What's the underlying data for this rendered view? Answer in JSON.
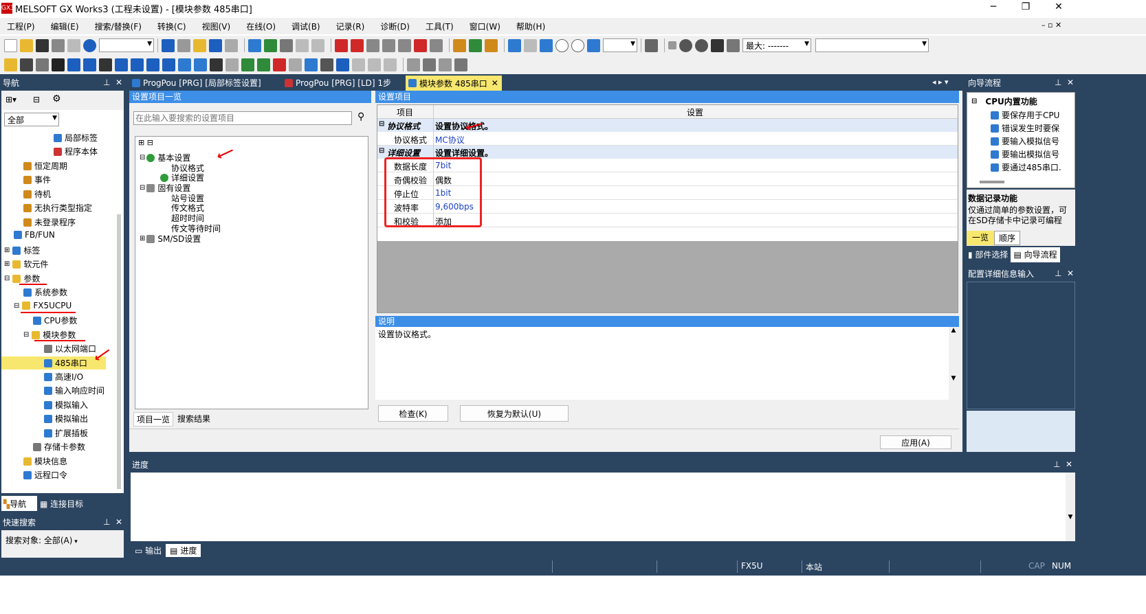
{
  "window": {
    "logo": "GX3",
    "title": "MELSOFT GX Works3 (工程未设置) - [模块参数 485串口]"
  },
  "menu": [
    "工程(P)",
    "编辑(E)",
    "搜索/替换(F)",
    "转换(C)",
    "视图(V)",
    "在线(O)",
    "调试(B)",
    "记录(R)",
    "诊断(D)",
    "工具(T)",
    "窗口(W)",
    "帮助(H)"
  ],
  "toolbar": {
    "zoom_label": "最大: -------"
  },
  "nav": {
    "title": "导航",
    "filter": "全部",
    "items": [
      "局部标签",
      "程序本体",
      "恒定周期",
      "事件",
      "待机",
      "无执行类型指定",
      "未登录程序",
      "FB/FUN",
      "标签",
      "软元件",
      "参数",
      "系统参数",
      "FX5UCPU",
      "CPU参数",
      "模块参数",
      "以太网端口",
      "485串口",
      "高速I/O",
      "输入响应时间",
      "模拟输入",
      "模拟输出",
      "扩展插板",
      "存储卡参数",
      "模块信息",
      "远程口令"
    ],
    "tabs": [
      "导航",
      "连接目标"
    ]
  },
  "quick_search": {
    "title": "快速搜索",
    "target": "搜索对象: 全部(A)"
  },
  "tabs": [
    "ProgPou [PRG] [局部标签设置]",
    "ProgPou [PRG] [LD] 1步",
    "模块参数 485串口"
  ],
  "settings_list": {
    "title": "设置项目一览",
    "search_placeholder": "在此输入要搜索的设置项目",
    "tree": [
      "基本设置",
      "协议格式",
      "详细设置",
      "固有设置",
      "站号设置",
      "传文格式",
      "超时时间",
      "传文等待时间",
      "SM/SD设置"
    ],
    "bottom_tabs": [
      "项目一览",
      "搜索结果"
    ]
  },
  "settings_items": {
    "title": "设置项目",
    "col_item": "项目",
    "col_setting": "设置",
    "group1": {
      "name": "协议格式",
      "desc": "设置协议格式。"
    },
    "row_protocol": {
      "label": "协议格式",
      "value": "MC协议"
    },
    "group2": {
      "name": "详细设置",
      "desc": "设置详细设置。"
    },
    "rows": [
      {
        "label": "数据长度",
        "value": "7bit"
      },
      {
        "label": "奇偶校验",
        "value": "偶数"
      },
      {
        "label": "停止位",
        "value": "1bit"
      },
      {
        "label": "波特率",
        "value": "9,600bps"
      },
      {
        "label": "和校验",
        "value": "添加"
      }
    ]
  },
  "description": {
    "title": "说明",
    "text": "设置协议格式。"
  },
  "buttons": {
    "check": "检查(K)",
    "restore": "恢复为默认(U)",
    "apply": "应用(A)"
  },
  "progress": {
    "title": "进度",
    "tabs": [
      "输出",
      "进度"
    ]
  },
  "guide": {
    "title": "向导流程",
    "group": "CPU内置功能",
    "items": [
      "要保存用于CPU",
      "错误发生时要保",
      "要输入模拟信号",
      "要输出模拟信号",
      "要通过485串口."
    ],
    "data_title": "数据记录功能",
    "data_text": "仅通过简单的参数设置，可在SD存储卡中记录可编程",
    "tabs_small": [
      "一览",
      "顺序"
    ],
    "tabs": [
      "部件选择",
      "向导流程"
    ]
  },
  "config_panel": {
    "title": "配置详细信息输入"
  },
  "statusbar": {
    "cpu": "FX5U",
    "station": "本站",
    "cap": "CAP",
    "num": "NUM"
  }
}
